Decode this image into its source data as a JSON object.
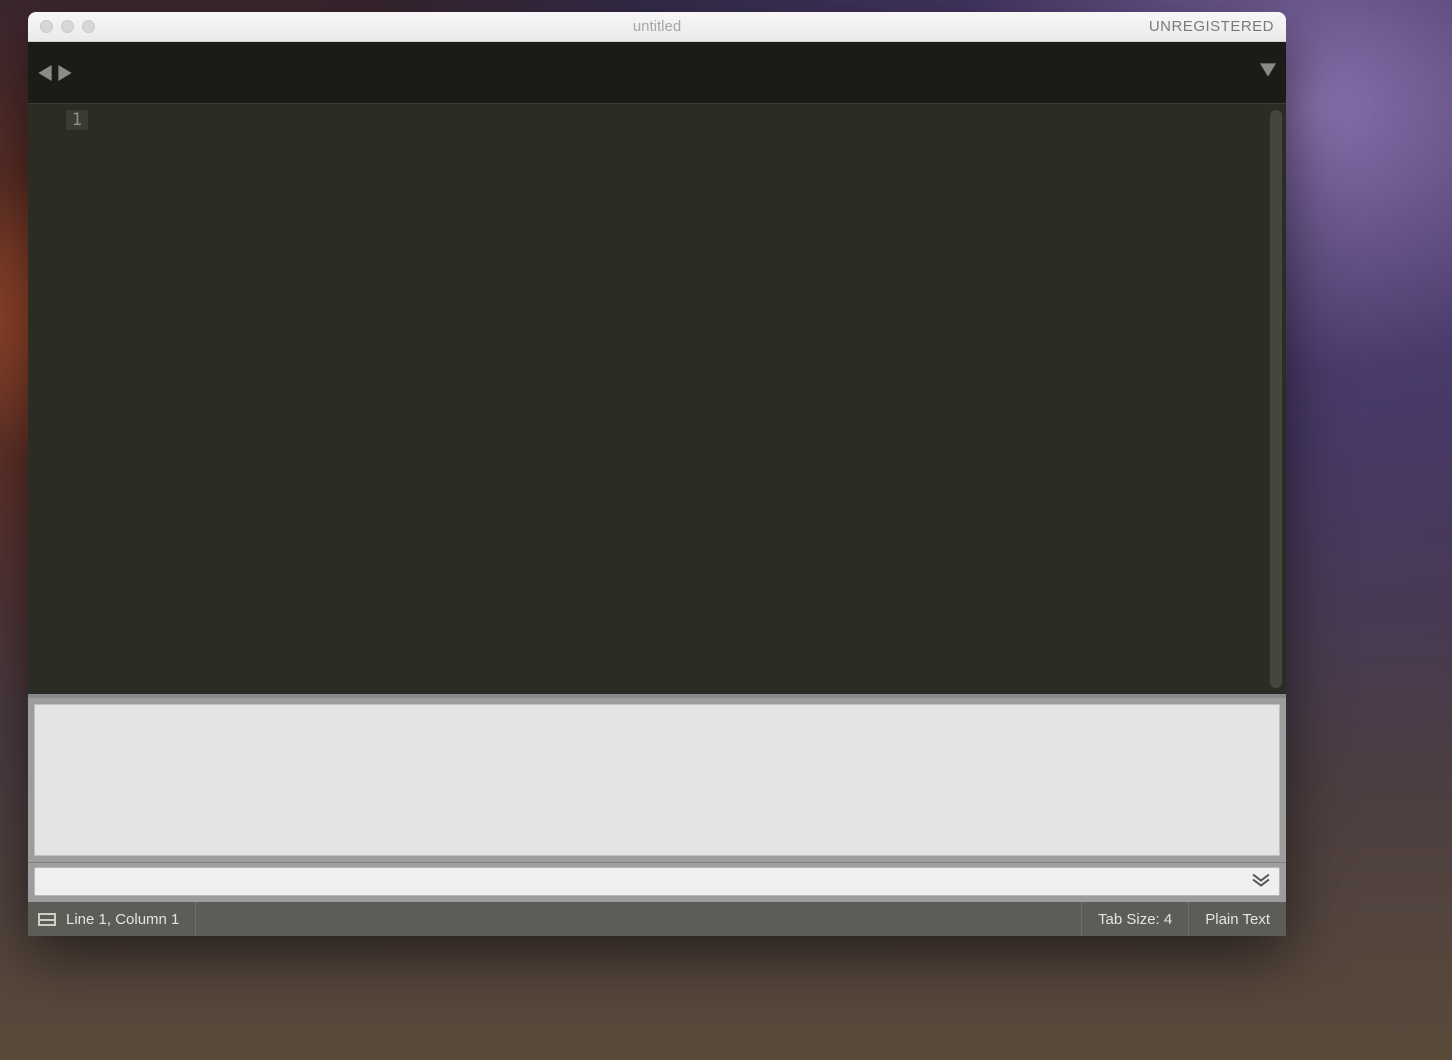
{
  "titlebar": {
    "title": "untitled",
    "registration": "UNREGISTERED"
  },
  "editor": {
    "line_numbers": [
      "1"
    ],
    "content": ""
  },
  "statusbar": {
    "cursor": "Line 1, Column 1",
    "tab_size": "Tab Size: 4",
    "syntax": "Plain Text"
  }
}
